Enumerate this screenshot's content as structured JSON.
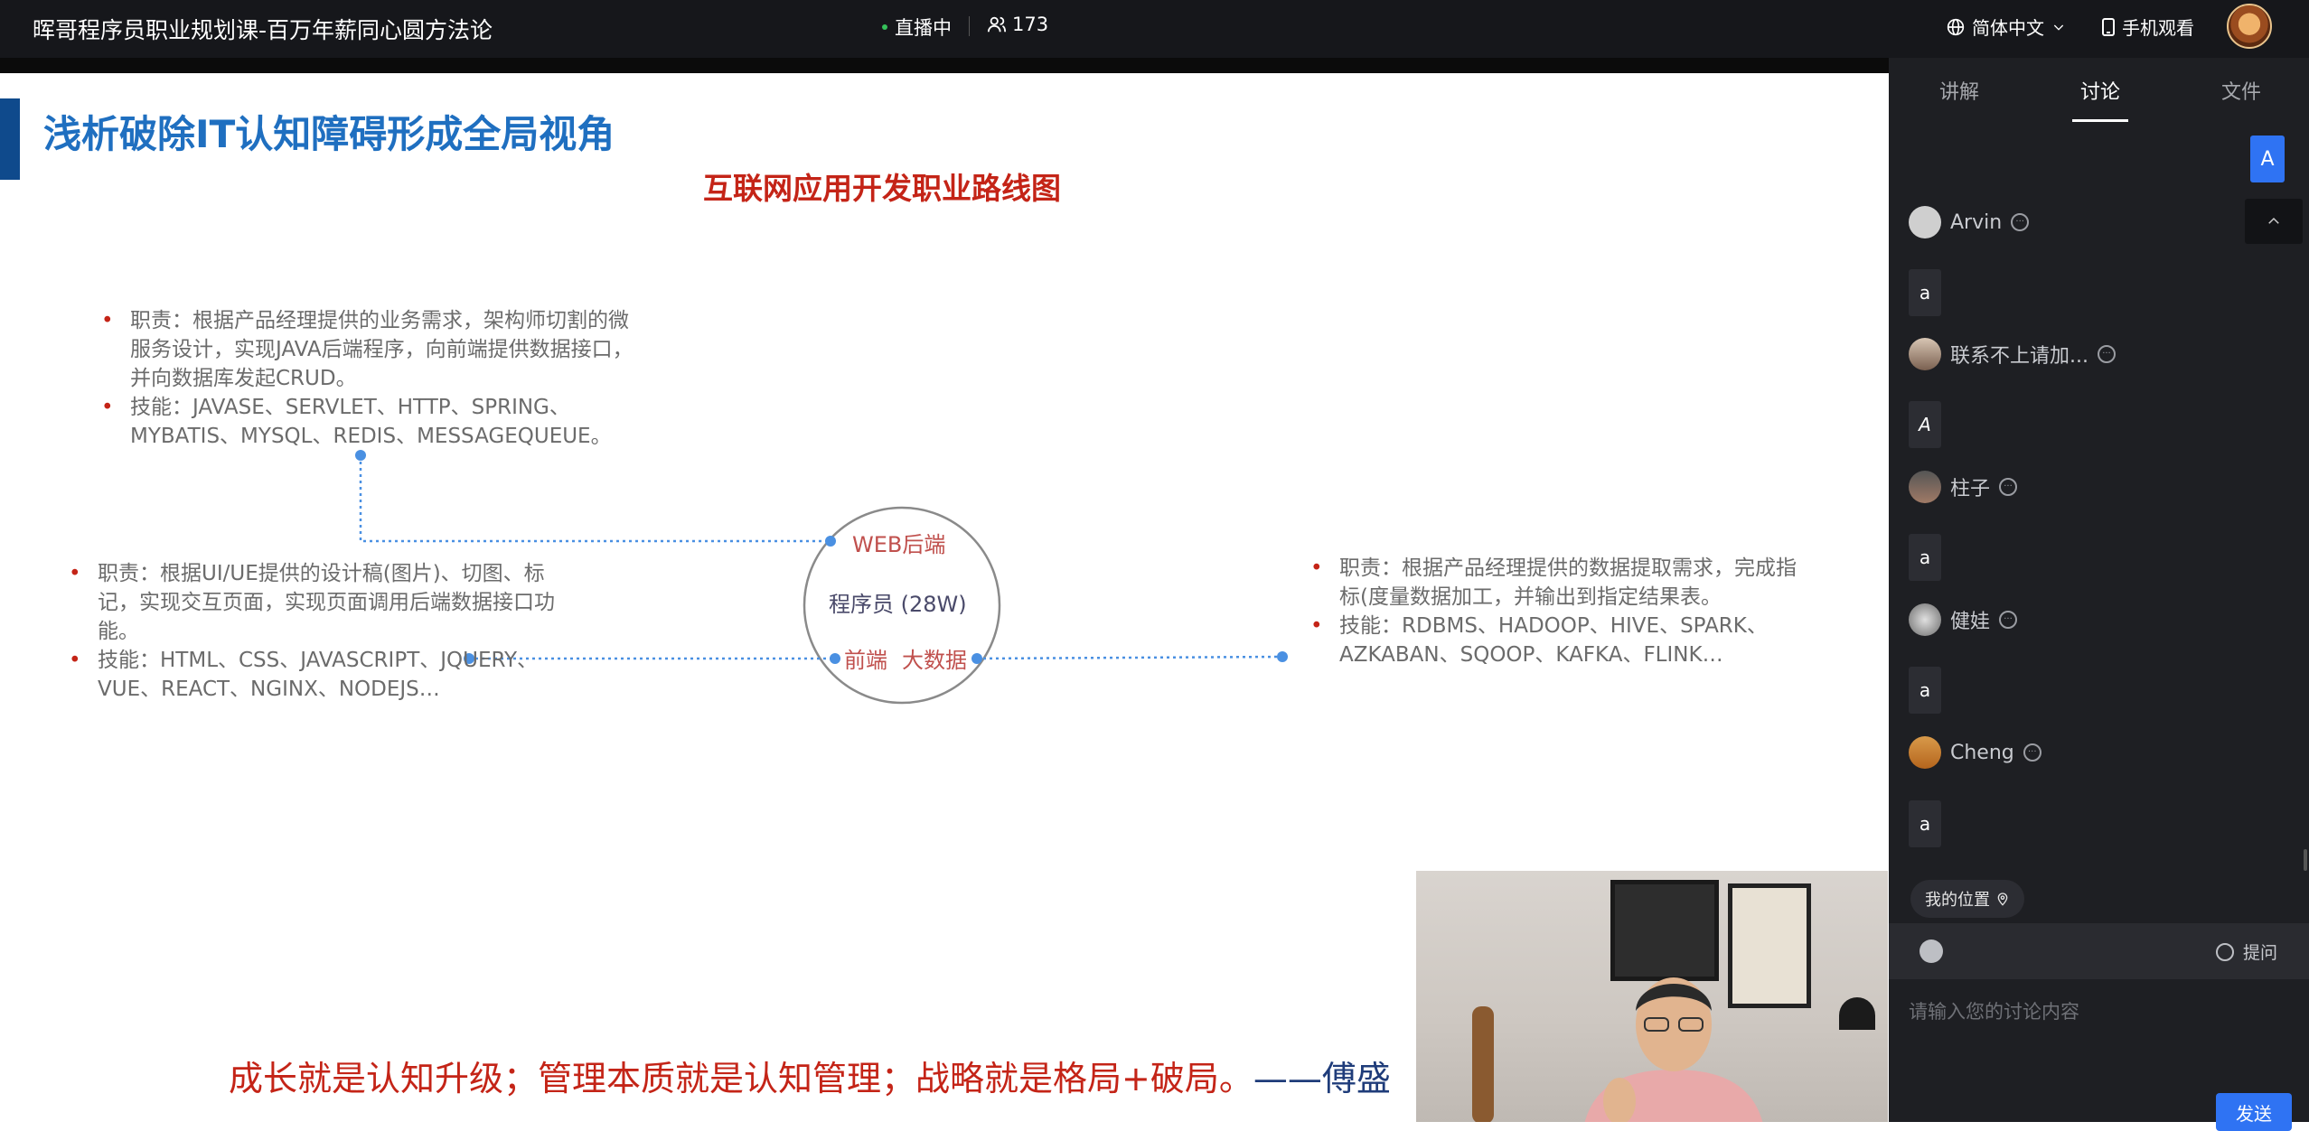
{
  "header": {
    "course_title": "晖哥程序员职业规划课-百万年薪同心圆方法论",
    "live_status": "直播中",
    "viewer_count": "173",
    "language": "简体中文",
    "mobile_watch": "手机观看"
  },
  "slide": {
    "heading": "浅析破除IT认知障碍形成全局视角",
    "subheading": "互联网应用开发职业路线图",
    "backend_block": {
      "duty": "职责：根据产品经理提供的业务需求，架构师切割的微服务设计，实现JAVA后端程序，向前端提供数据接口，并向数据库发起CRUD。",
      "skills": "技能：JAVASE、SERVLET、HTTP、SPRING、MYBATIS、MYSQL、REDIS、MESSAGEQUEUE。"
    },
    "frontend_block": {
      "duty": "职责：根据UI/UE提供的设计稿(图片)、切图、标记，实现交互页面，实现页面调用后端数据接口功能。",
      "skills": "技能：HTML、CSS、JAVASCRIPT、JQUERY、VUE、REACT、NGINX、NODEJS…"
    },
    "bigdata_block": {
      "duty": "职责：根据产品经理提供的数据提取需求，完成指标(度量数据加工，并输出到指定结果表。",
      "skills": "技能：RDBMS、HADOOP、HIVE、SPARK、AZKABAN、SQOOP、KAFKA、FLINK…"
    },
    "center_label": "程序员 (28W)",
    "node_backend": "WEB后端",
    "node_frontend": "前端",
    "node_bigdata": "大数据",
    "quote": "成长就是认知升级；管理本质就是认知管理；战略就是格局+破局。",
    "quote_author": "——傅盛"
  },
  "panel": {
    "tabs": [
      "讲解",
      "讨论",
      "文件"
    ],
    "active_tab": "讨论",
    "top_message": "A",
    "messages": [
      {
        "name": "Arvin",
        "text": "a"
      },
      {
        "name": "联系不上请加...",
        "text": "A"
      },
      {
        "name": "柱子",
        "text": "a"
      },
      {
        "name": "健娃",
        "text": "a"
      },
      {
        "name": "Cheng",
        "text": "a"
      }
    ],
    "my_position": "我的位置",
    "ask_label": "提问",
    "input_placeholder": "请输入您的讨论内容",
    "send_label": "发送"
  },
  "colors": {
    "accent_blue": "#2f73f3",
    "slide_title_blue": "#1f6fc0",
    "slide_red": "#c42417",
    "topbar": "#16171b",
    "panel_bg": "#1e1f23"
  }
}
